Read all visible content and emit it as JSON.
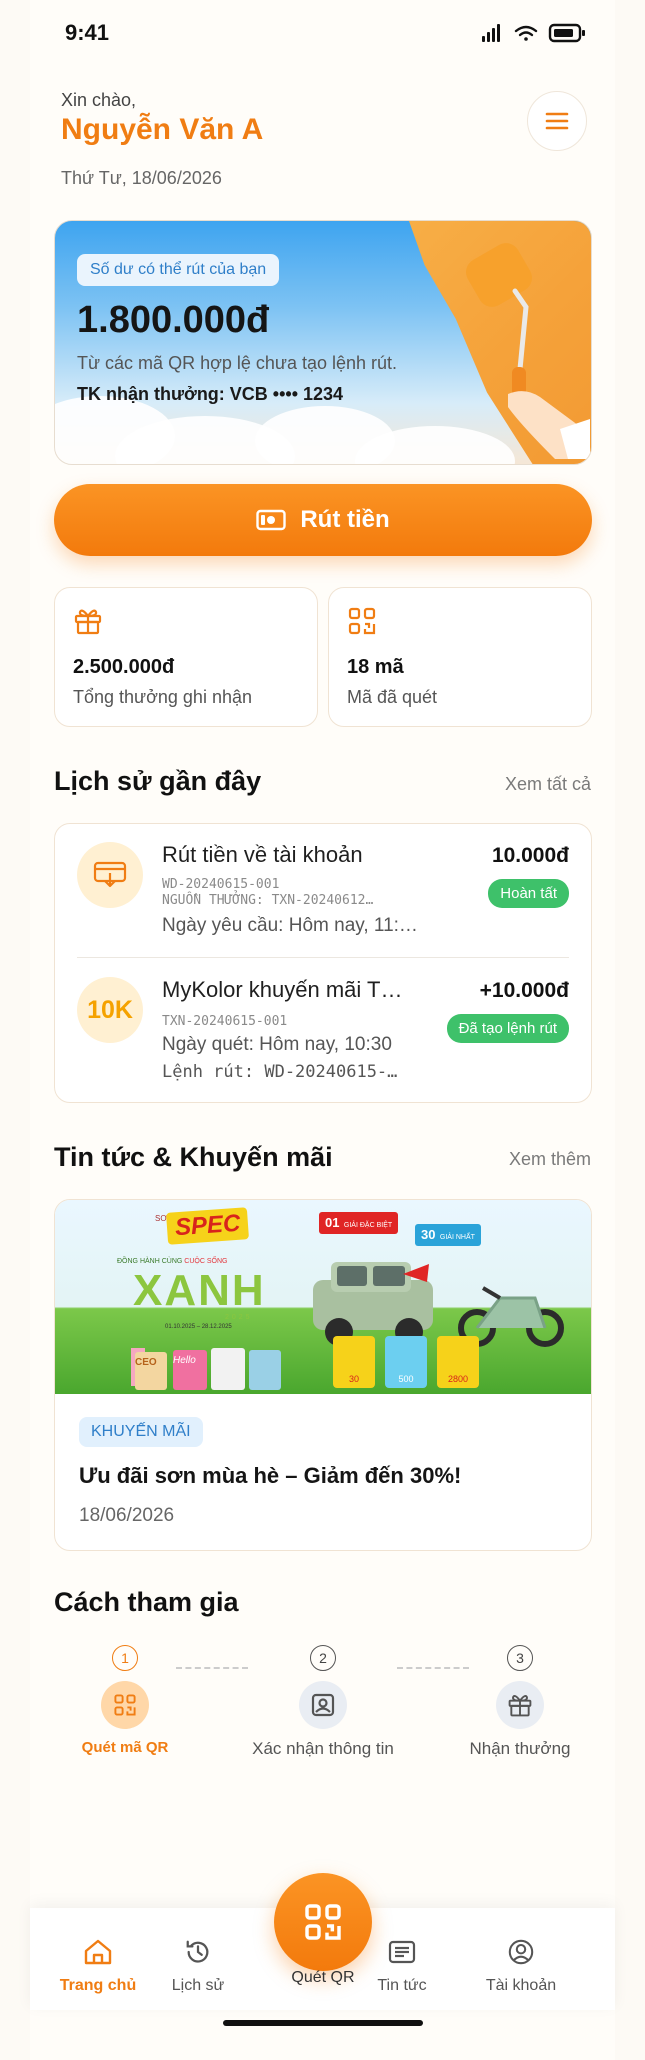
{
  "status_bar": {
    "time": "9:41"
  },
  "header": {
    "greeting": "Xin chào,",
    "user_name": "Nguyễn Văn A",
    "date": "Thứ Tư, 18/06/2026"
  },
  "balance": {
    "badge": "Số dư có thể rút của bạn",
    "amount": "1.800.000đ",
    "note": "Từ các mã QR hợp lệ chưa tạo lệnh rút.",
    "account": "TK nhận thưởng:  VCB •••• 1234"
  },
  "withdraw_button": {
    "label": "Rút tiền"
  },
  "stats": [
    {
      "value": "2.500.000đ",
      "label": "Tổng thưởng ghi nhận",
      "icon": "gift-icon"
    },
    {
      "value": "18 mã",
      "label": "Mã đã quét",
      "icon": "qr-icon"
    }
  ],
  "history": {
    "title": "Lịch sử gần đây",
    "link": "Xem tất cả",
    "items": [
      {
        "title": "Rút tiền về tài khoản",
        "code": "WD-20240615-001",
        "source": "NGUỒN THƯỞNG: TXN-20240612…",
        "detail": "Ngày yêu cầu: Hôm nay, 11:…",
        "amount": "10.000đ",
        "status": "Hoàn tất",
        "icon": "withdraw-icon"
      },
      {
        "title": "MyKolor khuyến mãi T…",
        "code": "TXN-20240615-001",
        "detail": "Ngày quét: Hôm nay, 10:30",
        "extra": "Lệnh rút: WD-20240615-…",
        "amount": "+10.000đ",
        "status": "Đã tạo lệnh rút",
        "badge_text": "10K"
      }
    ]
  },
  "news": {
    "title": "Tin tức & Khuyến mãi",
    "link": "Xem thêm",
    "banner": {
      "brand_prefix": "SƠN",
      "brand": "SPEC",
      "tagline_prefix": "ĐỒNG HÀNH CÙNG",
      "tagline_highlight": "CUỘC SỐNG",
      "headline": "XANH",
      "year": "2025",
      "prize_1_number": "01",
      "prize_1_label": "GIẢI ĐẶC BIỆT",
      "prize_2_number": "30",
      "prize_2_label": "GIẢI NHẤT",
      "date_from": "01.10.2025",
      "date_to": "28.12.2025",
      "prize_cards": [
        "30",
        "500",
        "2800"
      ],
      "products": [
        "CEO",
        "Hello"
      ]
    },
    "card": {
      "tag": "KHUYẾN MÃI",
      "headline": "Ưu đãi sơn mùa hè – Giảm đến 30%!",
      "date": "18/06/2026"
    }
  },
  "steps": {
    "title": "Cách tham gia",
    "items": [
      {
        "number": "1",
        "label": "Quét mã QR",
        "icon": "qr-icon",
        "active": true
      },
      {
        "number": "2",
        "label": "Xác nhận thông tin",
        "icon": "id-card-icon",
        "active": false
      },
      {
        "number": "3",
        "label": "Nhận thưởng",
        "icon": "gift-icon",
        "active": false
      }
    ]
  },
  "bottom_nav": {
    "items": [
      {
        "label": "Trang chủ",
        "icon": "home-icon",
        "active": true
      },
      {
        "label": "Lịch sử",
        "icon": "history-icon",
        "active": false
      },
      {
        "label": "Quét QR",
        "icon": "qr-scan-icon",
        "active": false
      },
      {
        "label": "Tin tức",
        "icon": "news-icon",
        "active": false
      },
      {
        "label": "Tài khoản",
        "icon": "account-icon",
        "active": false
      }
    ]
  },
  "colors": {
    "accent": "#f07d13",
    "success": "#3ec16a",
    "info": "#2f7fc9"
  }
}
